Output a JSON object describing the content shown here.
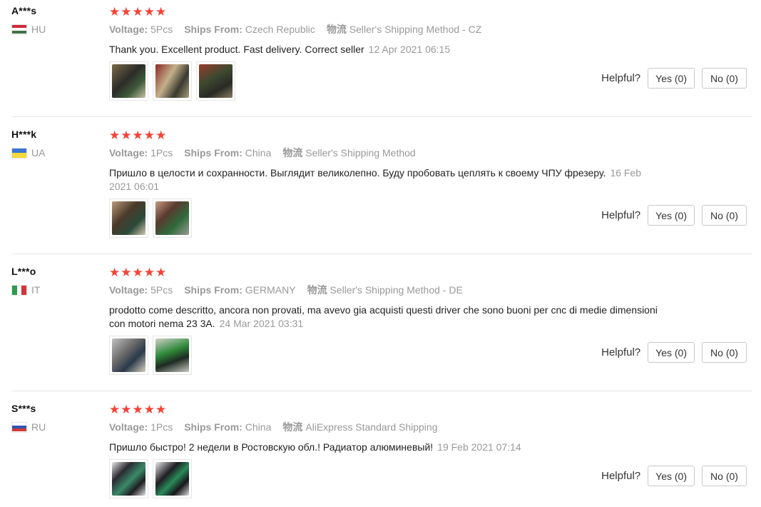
{
  "labels": {
    "voltage": "Voltage:",
    "ships_from": "Ships From:",
    "shipping_prefix": "物流",
    "helpful": "Helpful?"
  },
  "reviews": [
    {
      "user": "A***s",
      "country": "HU",
      "rating": 5,
      "voltage": "5Pcs",
      "ships_from": "Czech Republic",
      "shipping": "Seller's Shipping Method - CZ",
      "text": "Thank you. Excellent product. Fast delivery. Correct seller",
      "date": "12 Apr 2021 06:15",
      "yes": "Yes (0)",
      "no": "No (0)"
    },
    {
      "user": "H***k",
      "country": "UA",
      "rating": 5,
      "voltage": "1Pcs",
      "ships_from": "China",
      "shipping": "Seller's Shipping Method",
      "text": "Пришло в целости и сохранности. Выглядит великолепно. Буду пробовать цеплять к своему ЧПУ фрезеру.",
      "date": "16 Feb 2021 06:01",
      "yes": "Yes (0)",
      "no": "No (0)"
    },
    {
      "user": "L***o",
      "country": "IT",
      "rating": 5,
      "voltage": "5Pcs",
      "ships_from": "GERMANY",
      "shipping": "Seller's Shipping Method - DE",
      "text": "prodotto come descritto, ancora non provati, ma avevo gia acquisti questi driver che sono buoni per cnc di medie dimensioni con motori nema 23 3A.",
      "date": "24 Mar 2021 03:31",
      "yes": "Yes (0)",
      "no": "No (0)"
    },
    {
      "user": "S***s",
      "country": "RU",
      "rating": 5,
      "voltage": "1Pcs",
      "ships_from": "China",
      "shipping": "AliExpress Standard Shipping",
      "text": "Пришло быстро! 2 недели в Ростовскую обл.! Радиатор алюминевый!",
      "date": "19 Feb 2021 07:14",
      "yes": "Yes (0)",
      "no": "No (0)"
    }
  ],
  "colors": {
    "star": "#f44336",
    "muted": "#999999",
    "divider": "#e8e8e8"
  }
}
